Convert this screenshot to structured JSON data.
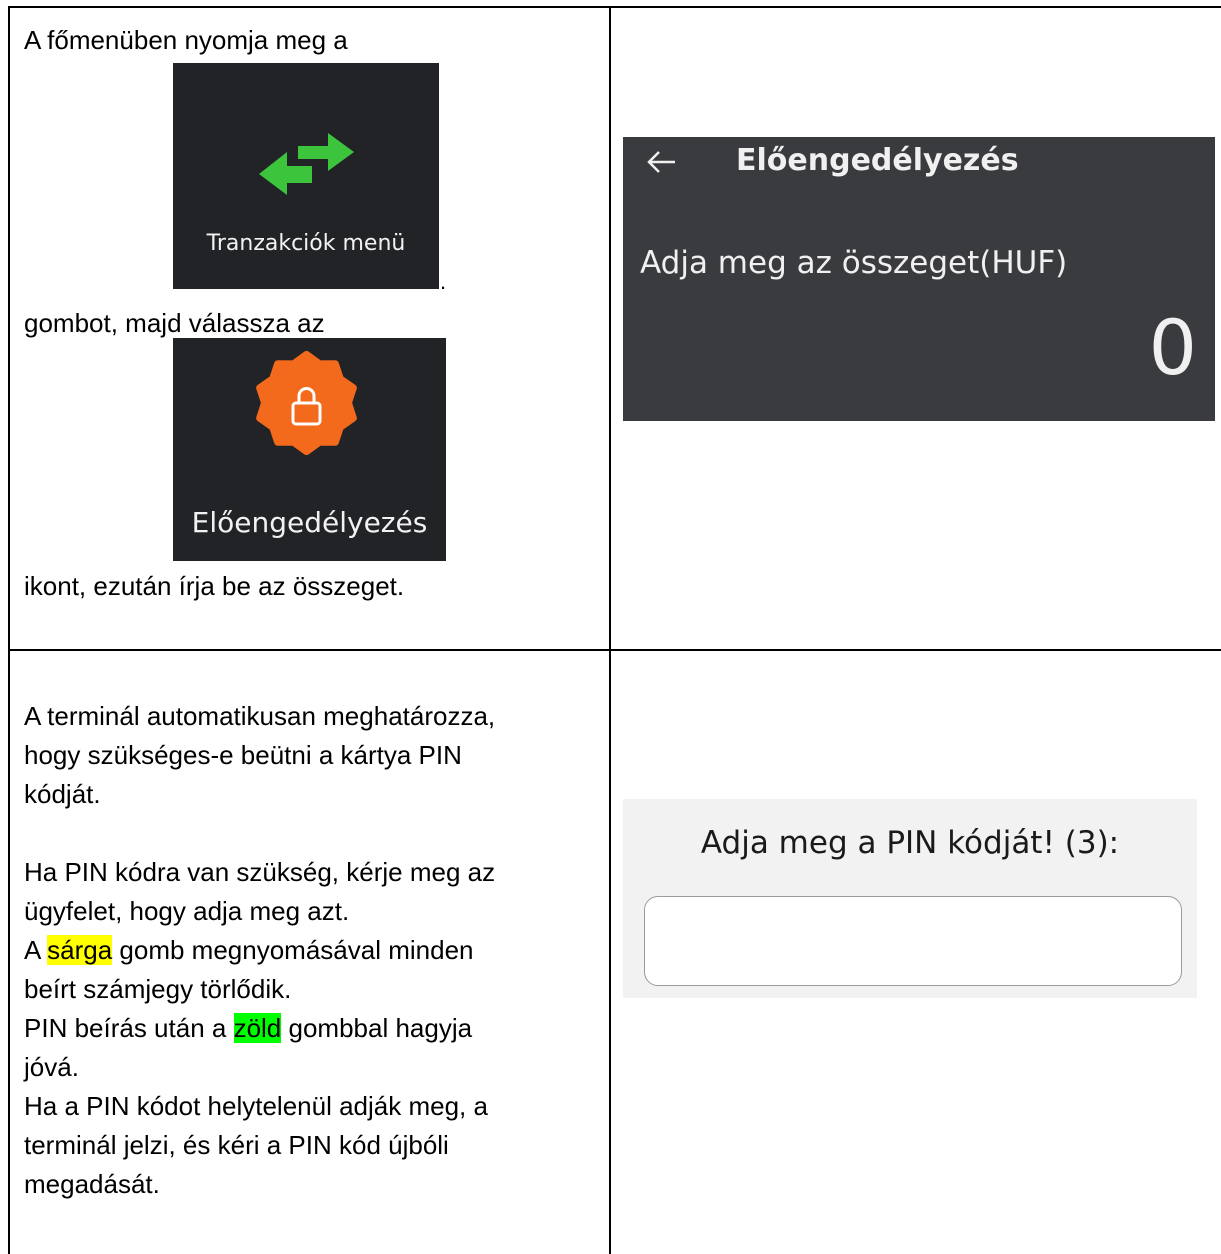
{
  "step1": {
    "intro": "A főmenüben nyomja meg a",
    "transactions_tile_label": "Tranzakciók menü",
    "period": ".",
    "then": "gombot, majd válassza az",
    "preauth_tile_label": "Előengedélyezés",
    "outro": "ikont, ezután írja be az összeget."
  },
  "amount_screen": {
    "title": "Előengedélyezés",
    "prompt": "Adja meg az összeget(HUF)",
    "amount": "0"
  },
  "step2": {
    "p1_l1": "A terminál automatikusan meghatározza,",
    "p1_l2": "hogy szükséges-e beütni a kártya PIN",
    "p1_l3": "kódját.",
    "p2_l1": "Ha PIN kódra van szükség, kérje meg az",
    "p2_l2": "ügyfelet, hogy adja meg azt.",
    "yellow_before": "A ",
    "yellow_word": "sárga",
    "yellow_after": " gomb megnyomásával minden",
    "p3_l2": "beírt számjegy törlődik.",
    "green_before": "PIN beírás után a ",
    "green_word": "zöld",
    "green_after": " gombbal hagyja",
    "p4_l2": "jóvá.",
    "p5_l1": "Ha a PIN kódot helytelenül adják meg, a",
    "p5_l2": "terminál jelzi, és kéri a PIN kód újbóli",
    "p5_l3": "megadását."
  },
  "pin_screen": {
    "title": "Adja meg a PIN kódját! (3):",
    "input_value": ""
  },
  "colors": {
    "highlight_yellow": "#ffff00",
    "highlight_green": "#00ff00",
    "arrow_green": "#3cc43c",
    "badge_orange": "#f36a1d",
    "screen_dark": "#3a3b3f"
  }
}
